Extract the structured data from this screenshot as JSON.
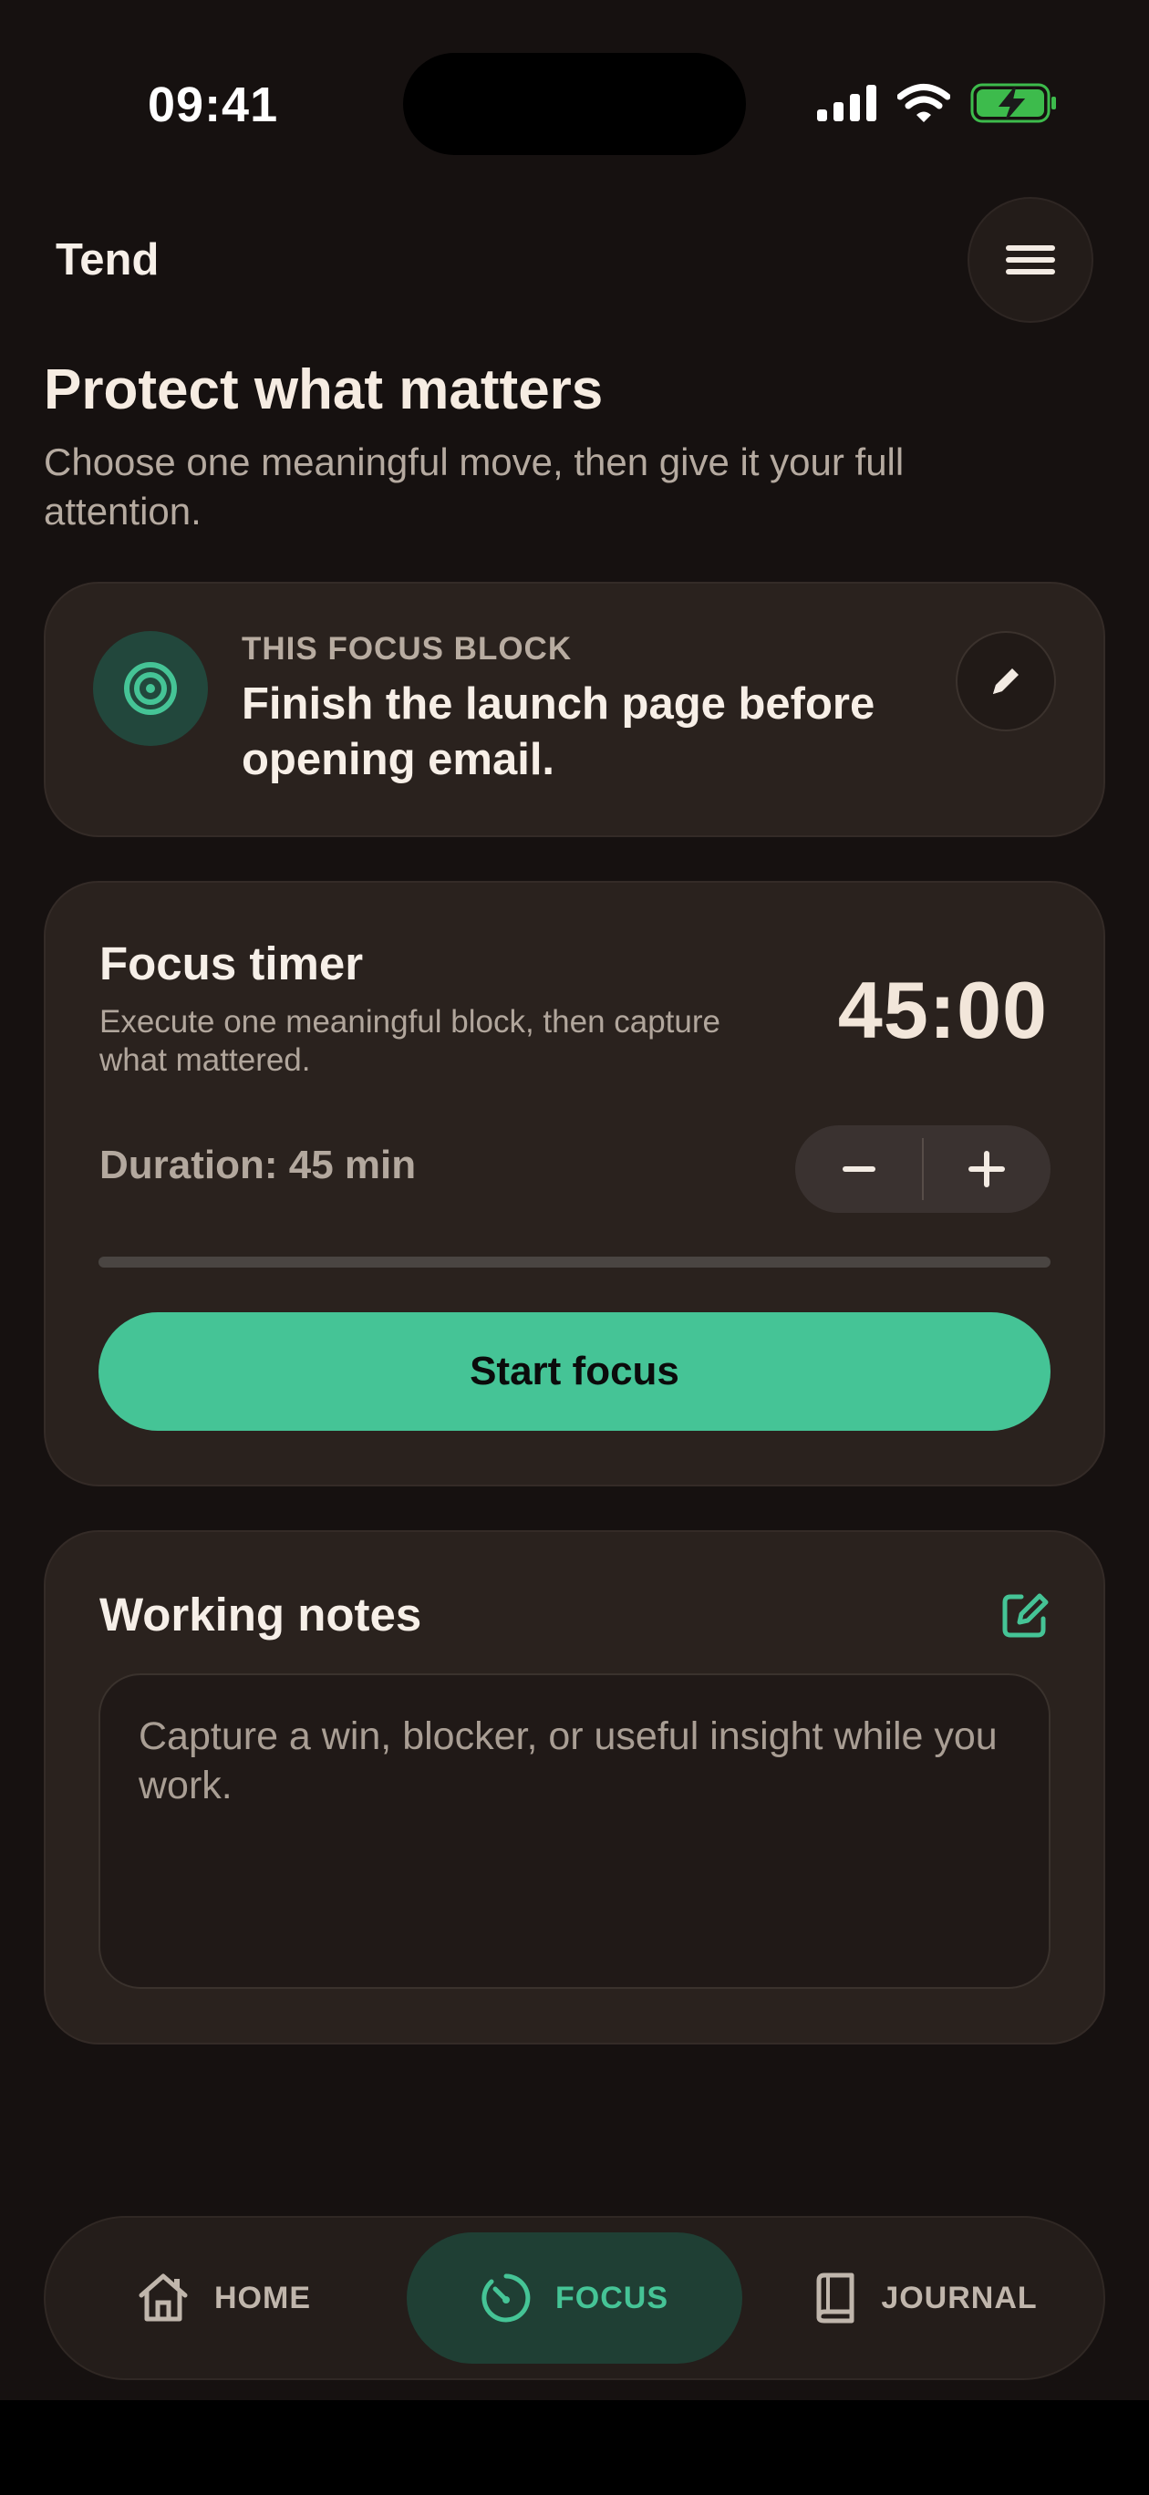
{
  "status_bar": {
    "time": "09:41"
  },
  "header": {
    "brand": "Tend",
    "menu_icon": "hamburger-icon"
  },
  "page": {
    "title": "Protect what matters",
    "subtitle": "Choose one meaningful move, then give it your full attention."
  },
  "focus_block": {
    "eyebrow": "THIS FOCUS BLOCK",
    "goal": "Finish the launch page before opening email.",
    "icon": "target-icon",
    "edit_icon": "pencil-icon"
  },
  "timer": {
    "title": "Focus timer",
    "description": "Execute one meaningful block, then capture what mattered.",
    "value": "45:00",
    "duration_label": "Duration: 45 min",
    "decrement_label": "−",
    "increment_label": "+",
    "progress": 0,
    "start_label": "Start focus"
  },
  "notes": {
    "title": "Working notes",
    "placeholder": "Capture a win, blocker, or useful insight while you work.",
    "edit_icon": "compose-icon"
  },
  "bottom_nav": {
    "items": [
      {
        "label": "HOME",
        "icon": "home-icon",
        "active": false
      },
      {
        "label": "FOCUS",
        "icon": "timer-icon",
        "active": true
      },
      {
        "label": "JOURNAL",
        "icon": "book-icon",
        "active": false
      }
    ]
  },
  "colors": {
    "accent": "#45c496",
    "background": "#161110",
    "card": "#2a221e"
  }
}
